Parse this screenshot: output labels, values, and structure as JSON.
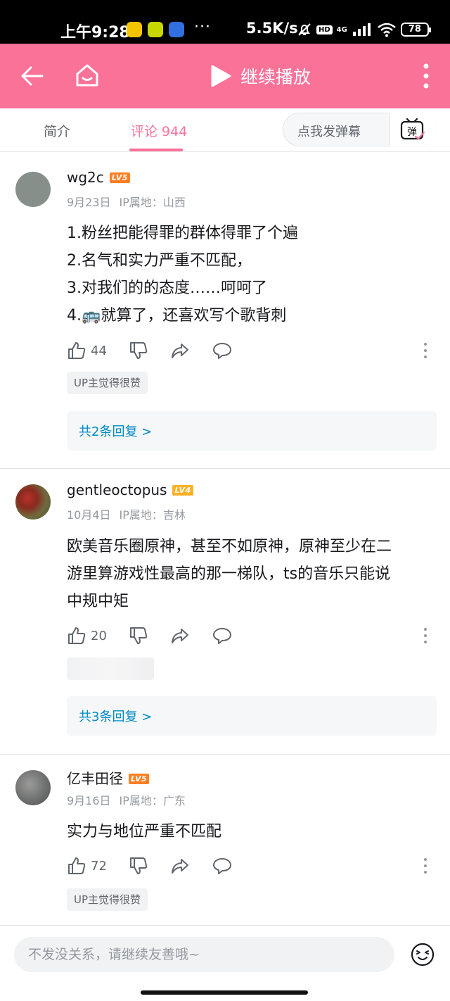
{
  "status_bar": {
    "time": "上午9:28",
    "more": "···",
    "net_speed": "5.5K/s",
    "hd": "HD",
    "network": "4G",
    "battery": "78"
  },
  "header": {
    "title": "继续播放",
    "accent_color": "#fb7299"
  },
  "tabs": {
    "intro": "简介",
    "comments": "评论 944",
    "danmaku_placeholder": "点我发弹幕",
    "danmaku_icon_text": "弹"
  },
  "comments": [
    {
      "username": "wg2c",
      "level": "LV5",
      "level_color": "#ff7f24",
      "date": "9月23日",
      "ip": "IP属地：山西",
      "lines": [
        "1.粉丝把能得罪的群体得罪了个遍",
        "2.名气和实力严重不匹配，",
        "3.对我们的的态度……呵呵了",
        "4.🚌就算了，还喜欢写个歌背刺"
      ],
      "likes": "44",
      "tag": "UP主觉得很赞",
      "replies": "共2条回复 >"
    },
    {
      "username": "gentleoctopus",
      "level": "LV4",
      "level_color": "#ffb027",
      "date": "10月4日",
      "ip": "IP属地：吉林",
      "lines": [
        "欧美音乐圈原神，甚至不如原神，原神至少在二",
        "游里算游戏性最高的那一梯队，ts的音乐只能说",
        "中规中矩"
      ],
      "likes": "20",
      "replies": "共3条回复 >"
    },
    {
      "username": "亿丰田径",
      "level": "LV5",
      "level_color": "#ff7f24",
      "date": "9月16日",
      "ip": "IP属地：广东",
      "lines": [
        "实力与地位严重不匹配"
      ],
      "likes": "72",
      "tag": "UP主觉得很赞"
    }
  ],
  "input": {
    "placeholder": "不发没关系，请继续友善哦~"
  }
}
